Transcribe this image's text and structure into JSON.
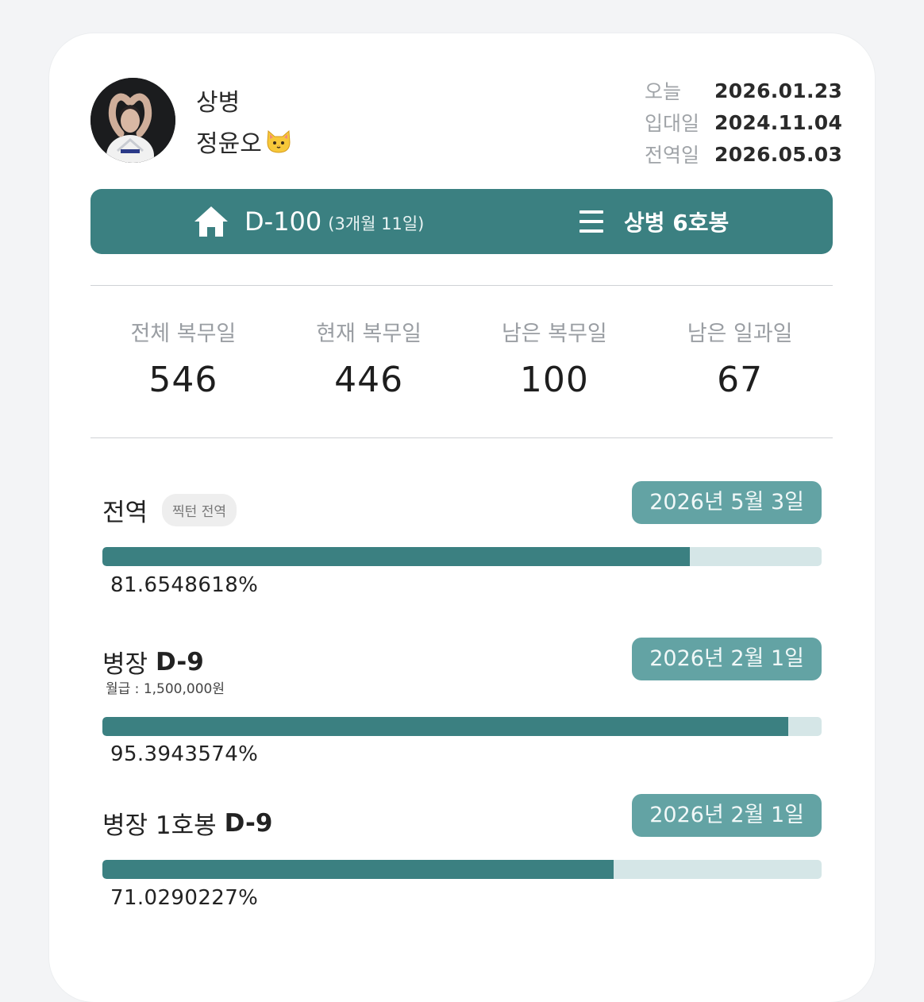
{
  "profile": {
    "rank": "상병",
    "name": "정윤오",
    "name_emoji": "cat-face-icon"
  },
  "dates": [
    {
      "label": "오늘",
      "value": "2026.01.23"
    },
    {
      "label": "입대일",
      "value": "2024.11.04"
    },
    {
      "label": "전역일",
      "value": "2026.05.03"
    }
  ],
  "banner": {
    "dday": "D-100",
    "dday_detail": "(3개월 11일)",
    "pay_grade": "상병 6호봉",
    "left_icon": "home-icon",
    "right_icon": "menu-icon"
  },
  "stats": [
    {
      "label": "전체 복무일",
      "value": "546"
    },
    {
      "label": "현재 복무일",
      "value": "446"
    },
    {
      "label": "남은 복무일",
      "value": "100"
    },
    {
      "label": "남은 일과일",
      "value": "67"
    }
  ],
  "progress": [
    {
      "title": "전역",
      "title_bold": "",
      "chip": "찍턴 전역",
      "note": "",
      "date": "2026년 5월 3일",
      "percent_text": "81.6548618%",
      "percent": 81.6548618
    },
    {
      "title": "병장",
      "title_bold": "D-9",
      "chip": "",
      "note": "월급 : 1,500,000원",
      "date": "2026년 2월 1일",
      "percent_text": "95.3943574%",
      "percent": 95.3943574
    },
    {
      "title": "병장 1호봉",
      "title_bold": "D-9",
      "chip": "",
      "note": "",
      "date": "2026년 2월 1일",
      "percent_text": "71.0290227%",
      "percent": 71.0290227
    }
  ],
  "colors": {
    "accent": "#3b8081",
    "pill": "#63a3a4",
    "track": "#d5e6e7"
  }
}
